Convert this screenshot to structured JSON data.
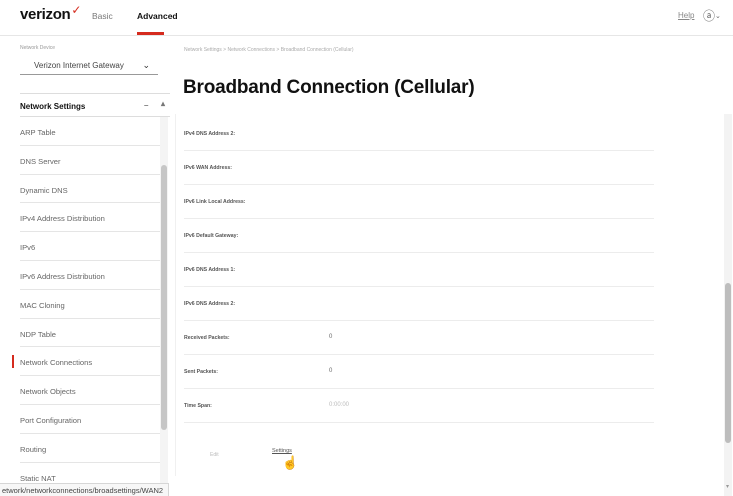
{
  "nav": {
    "logo": "verizon",
    "logo_mark": "✓",
    "tabs": [
      {
        "label": "Basic"
      },
      {
        "label": "Advanced"
      }
    ],
    "help": "Help",
    "user_icon": "user-circle-icon",
    "user_glyph": "ⓐ",
    "caret": "⌄"
  },
  "sidebar": {
    "device_label": "Network Device",
    "device_select": "Verizon Internet Gateway",
    "device_chevron": "⌄",
    "section_title": "Network Settings",
    "collapse_glyph": "–",
    "scroll_up_glyph": "▴",
    "items": [
      {
        "label": "ARP Table"
      },
      {
        "label": "DNS Server"
      },
      {
        "label": "Dynamic DNS"
      },
      {
        "label": "IPv4 Address Distribution"
      },
      {
        "label": "IPv6"
      },
      {
        "label": "IPv6 Address Distribution"
      },
      {
        "label": "MAC Cloning"
      },
      {
        "label": "NDP Table"
      },
      {
        "label": "Network Connections"
      },
      {
        "label": "Network Objects"
      },
      {
        "label": "Port Configuration"
      },
      {
        "label": "Routing"
      },
      {
        "label": "Static NAT"
      }
    ],
    "active_item": "Network Connections"
  },
  "main": {
    "breadcrumb": "Network Settings > Network Connections > Broadband Connection (Cellular)",
    "title": "Broadband Connection (Cellular)",
    "rows": [
      {
        "label": "IPv4 DNS Address 2:",
        "value": ""
      },
      {
        "label": "IPv6 WAN Address:",
        "value": ""
      },
      {
        "label": "IPv6 Link Local Address:",
        "value": ""
      },
      {
        "label": "IPv6 Default Gateway:",
        "value": ""
      },
      {
        "label": "IPv6 DNS Address 1:",
        "value": ""
      },
      {
        "label": "IPv6 DNS Address 2:",
        "value": ""
      },
      {
        "label": "Received Packets:",
        "value": "0"
      },
      {
        "label": "Sent Packets:",
        "value": "0"
      },
      {
        "label": "Time Span:",
        "value": "0:00:00"
      }
    ],
    "ghost_button": "Edit",
    "settings_button": "Settings",
    "cursor_glyph": "☝",
    "scroll_down_glyph": "▾"
  },
  "status_bar": "etwork/networkconnections/broadsettings/WAN2",
  "colors": {
    "accent": "#d52b1e",
    "text": "#222222",
    "muted": "#777777"
  }
}
